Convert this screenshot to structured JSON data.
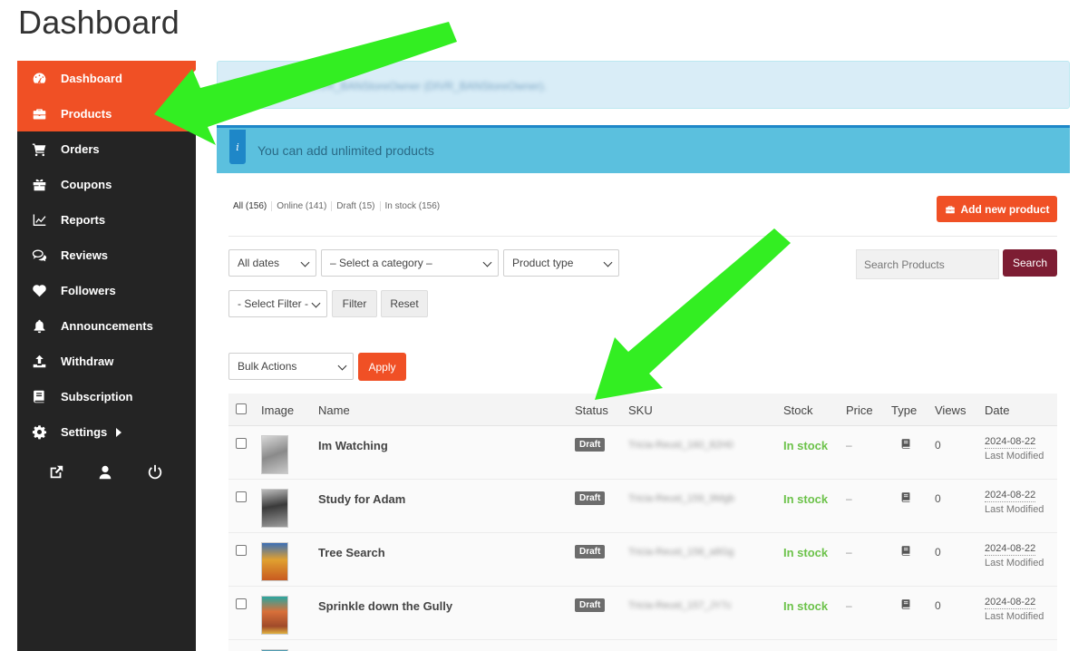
{
  "page_title": "Dashboard",
  "sidebar": {
    "items": [
      {
        "label": "Dashboard",
        "icon": "dashboard-gauge-icon",
        "active": true
      },
      {
        "label": "Products",
        "icon": "briefcase-icon",
        "active": true
      },
      {
        "label": "Orders",
        "icon": "shopping-cart-icon",
        "active": false
      },
      {
        "label": "Coupons",
        "icon": "gift-icon",
        "active": false
      },
      {
        "label": "Reports",
        "icon": "line-chart-icon",
        "active": false
      },
      {
        "label": "Reviews",
        "icon": "comments-icon",
        "active": false
      },
      {
        "label": "Followers",
        "icon": "heart-icon",
        "active": false
      },
      {
        "label": "Announcements",
        "icon": "bell-icon",
        "active": false
      },
      {
        "label": "Withdraw",
        "icon": "upload-icon",
        "active": false
      },
      {
        "label": "Subscription",
        "icon": "book-icon",
        "active": false
      },
      {
        "label": "Settings",
        "icon": "gear-icon",
        "active": false
      }
    ],
    "footer_icons": [
      "external-link-icon",
      "user-icon",
      "power-icon"
    ]
  },
  "notices": {
    "top_blurred": "DIVR_BANStoreOwner (DIVR_BANStoreOwner).",
    "info": "You can add unlimited products"
  },
  "status_filters": [
    "All (156)",
    "Online (141)",
    "Draft (15)",
    "In stock (156)"
  ],
  "add_button": "Add new product",
  "filters": {
    "dates": "All dates",
    "category": "– Select a category –",
    "product_type": "Product type",
    "select_filter": "- Select Filter -",
    "filter_button": "Filter",
    "reset_button": "Reset",
    "search_placeholder": "Search Products",
    "search_button": "Search",
    "bulk_actions": "Bulk Actions",
    "apply_button": "Apply"
  },
  "table": {
    "headers": [
      "Image",
      "Name",
      "Status",
      "SKU",
      "Stock",
      "Price",
      "Type",
      "Views",
      "Date"
    ],
    "rows": [
      {
        "name": "Im Watching",
        "status": "Draft",
        "sku": "Tricia-Reust_160_82H0",
        "stock": "In stock",
        "price": "–",
        "views": "0",
        "date": "2024-08-22",
        "modified": "Last Modified"
      },
      {
        "name": "Study for Adam",
        "status": "Draft",
        "sku": "Tricia-Reust_159_9Mgb",
        "stock": "In stock",
        "price": "–",
        "views": "0",
        "date": "2024-08-22",
        "modified": "Last Modified"
      },
      {
        "name": "Tree Search",
        "status": "Draft",
        "sku": "Tricia-Reust_158_a8Gg",
        "stock": "In stock",
        "price": "–",
        "views": "0",
        "date": "2024-08-22",
        "modified": "Last Modified"
      },
      {
        "name": "Sprinkle down the Gully",
        "status": "Draft",
        "sku": "Tricia-Reust_157_JY7c",
        "stock": "In stock",
        "price": "–",
        "views": "0",
        "date": "2024-08-22",
        "modified": "Last Modified"
      }
    ]
  },
  "colors": {
    "accent": "#f05025",
    "sidebar_bg": "#242424",
    "search_btn": "#7d1d33",
    "stock_green": "#6cc24a",
    "arrow_green": "#33ee22"
  }
}
